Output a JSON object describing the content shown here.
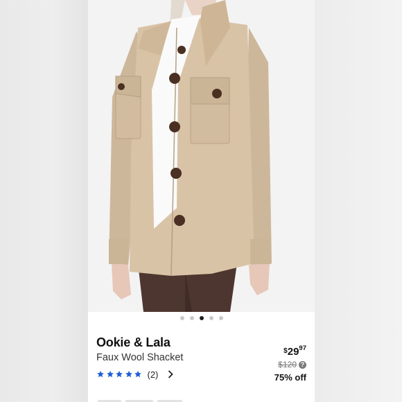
{
  "product": {
    "brand": "Ookie & Lala",
    "title": "Faux Wool Shacket",
    "rating_count": "(2)",
    "rating_stars": 5,
    "price_dollar": "$",
    "price_whole": "29",
    "price_cents": "97",
    "original_price": "$120",
    "discount": "75% off",
    "help_glyph": "?"
  },
  "carousel": {
    "total": 5,
    "active_index": 2
  },
  "colors": {
    "star": "#1f5fd6",
    "coat": "#d9c3a6",
    "button": "#4a3022"
  },
  "icons": {
    "rating": "star-icon",
    "navigate": "chevron-right-icon",
    "help": "question-circle-icon"
  }
}
